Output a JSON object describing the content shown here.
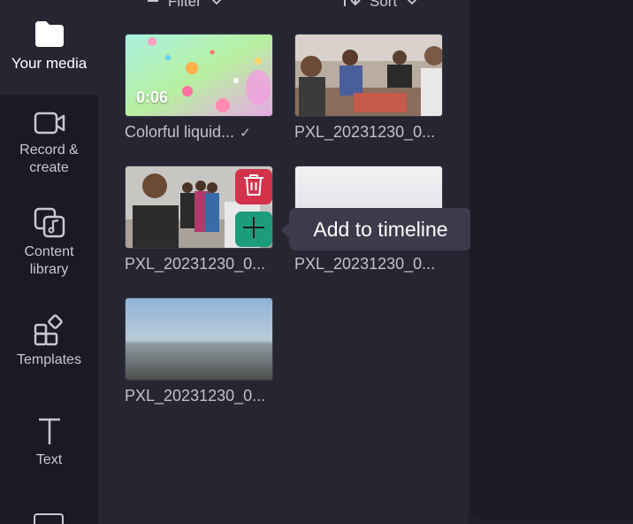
{
  "sidebar": {
    "items": [
      {
        "label": "Your media",
        "icon": "folder-icon"
      },
      {
        "label": "Record &\ncreate",
        "icon": "video-camera-icon"
      },
      {
        "label": "Content\nlibrary",
        "icon": "content-library-icon"
      },
      {
        "label": "Templates",
        "icon": "templates-icon"
      },
      {
        "label": "Text",
        "icon": "text-icon"
      }
    ]
  },
  "toolbar": {
    "filter_label": "Filter",
    "sort_label": "Sort"
  },
  "media": {
    "items": [
      {
        "name": "Colorful liquid...",
        "duration": "0:06",
        "added": true
      },
      {
        "name": "PXL_20231230_0..."
      },
      {
        "name": "PXL_20231230_0..."
      },
      {
        "name": "PXL_20231230_0..."
      },
      {
        "name": "PXL_20231230_0..."
      }
    ]
  },
  "tooltip": {
    "text": "Add to timeline"
  },
  "colors": {
    "accent_green": "#1c9c7d",
    "delete_red": "#d2334b",
    "panel_bg": "#262633",
    "sidebar_bg": "#1a1a24"
  }
}
